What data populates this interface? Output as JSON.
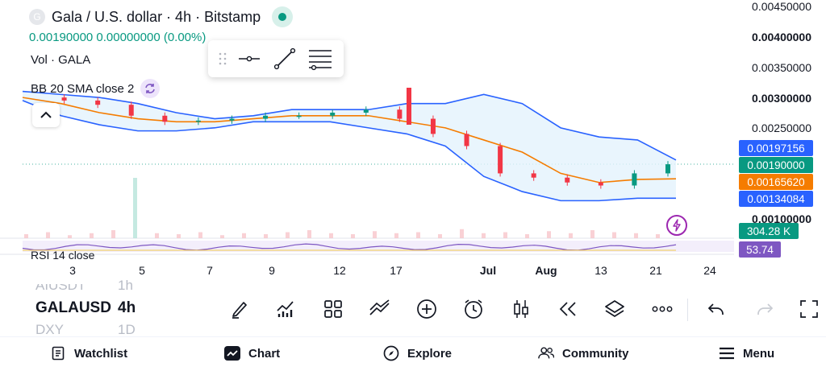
{
  "header": {
    "symbol_icon": "G",
    "title": "Gala / U.S. dollar · 4h · Bitstamp",
    "ohlc": "0.00190000  0.00000000 (0.00%)"
  },
  "indicators": {
    "volume_label": "Vol · GALA",
    "bb_label": "BB 20 SMA close 2",
    "rsi_label": "RSI 14 close"
  },
  "price_axis": [
    "0.00450000",
    "0.00400000",
    "0.00350000",
    "0.00300000",
    "0.00250000",
    "0.00100000"
  ],
  "price_tags": [
    {
      "value": "0.00197156",
      "color": "#2962ff"
    },
    {
      "value": "0.00190000",
      "color": "#089981"
    },
    {
      "value": "0.00165620",
      "color": "#f57c00"
    },
    {
      "value": "0.00134084",
      "color": "#2962ff"
    },
    {
      "value": "304.28 K",
      "color": "#089981"
    },
    {
      "value": "53.74",
      "color": "#7e57c2"
    }
  ],
  "time_axis": [
    {
      "label": "3",
      "bold": false
    },
    {
      "label": "5",
      "bold": false
    },
    {
      "label": "7",
      "bold": false
    },
    {
      "label": "9",
      "bold": false
    },
    {
      "label": "12",
      "bold": false
    },
    {
      "label": "17",
      "bold": false
    },
    {
      "label": "Jul",
      "bold": true
    },
    {
      "label": "Aug",
      "bold": true
    },
    {
      "label": "13",
      "bold": false
    },
    {
      "label": "21",
      "bold": false
    },
    {
      "label": "24",
      "bold": false
    }
  ],
  "tickers": {
    "prev": "AIUSDT",
    "current": "GALAUSD",
    "next": "DXY"
  },
  "timeframes": {
    "prev": "1h",
    "current": "4h",
    "next": "1D"
  },
  "toolbar_icons": [
    "brush-icon",
    "indicators-icon",
    "templates-icon",
    "compare-icon",
    "add-icon",
    "alert-clock-icon",
    "candles-icon",
    "replay-icon",
    "layers-icon",
    "more-icon",
    "undo-icon",
    "redo-icon",
    "fullscreen-icon"
  ],
  "nav": {
    "watchlist": "Watchlist",
    "chart": "Chart",
    "explore": "Explore",
    "community": "Community",
    "menu": "Menu"
  },
  "colors": {
    "up": "#089981",
    "down": "#f23645",
    "bb_band": "#2962ff",
    "bb_basis": "#f57c00",
    "bb_fill": "#e3f2fd",
    "rsi": "#7e57c2"
  },
  "chart_data": {
    "type": "candlestick",
    "timeframe": "4h",
    "indicators": [
      "Bollinger Bands (20, SMA, close, 2)",
      "Volume",
      "RSI (14, close)"
    ],
    "price_ylim": [
      0.001,
      0.0045
    ],
    "last_price": 0.0019,
    "bb_upper_last": 0.00197156,
    "bb_basis_last": 0.0016562,
    "bb_lower_last": 0.00134084,
    "volume_last": "304.28 K",
    "rsi_last": 53.74,
    "bb_upper": [
      0.0031,
      0.00305,
      0.003,
      0.0029,
      0.00275,
      0.00265,
      0.0027,
      0.0028,
      0.0028,
      0.0028,
      0.0029,
      0.0029,
      0.00305,
      0.0029,
      0.0025,
      0.00235,
      0.0023,
      0.00197
    ],
    "bb_basis": [
      0.003,
      0.0029,
      0.00275,
      0.00265,
      0.0026,
      0.0026,
      0.00265,
      0.0027,
      0.0027,
      0.0027,
      0.0026,
      0.0025,
      0.0023,
      0.0021,
      0.00175,
      0.0016,
      0.00165,
      0.00166
    ],
    "bb_lower": [
      0.00295,
      0.0027,
      0.00255,
      0.00245,
      0.00245,
      0.0025,
      0.0026,
      0.0026,
      0.0026,
      0.0025,
      0.0024,
      0.0022,
      0.0017,
      0.00145,
      0.0013,
      0.0013,
      0.00134,
      0.00134
    ],
    "candle_closes": [
      0.003,
      0.00295,
      0.00288,
      0.0027,
      0.0026,
      0.00262,
      0.00265,
      0.0027,
      0.0027,
      0.00275,
      0.0028,
      0.00265,
      0.0024,
      0.0022,
      0.00175,
      0.00168,
      0.0016,
      0.00155,
      0.00175,
      0.0019
    ]
  }
}
